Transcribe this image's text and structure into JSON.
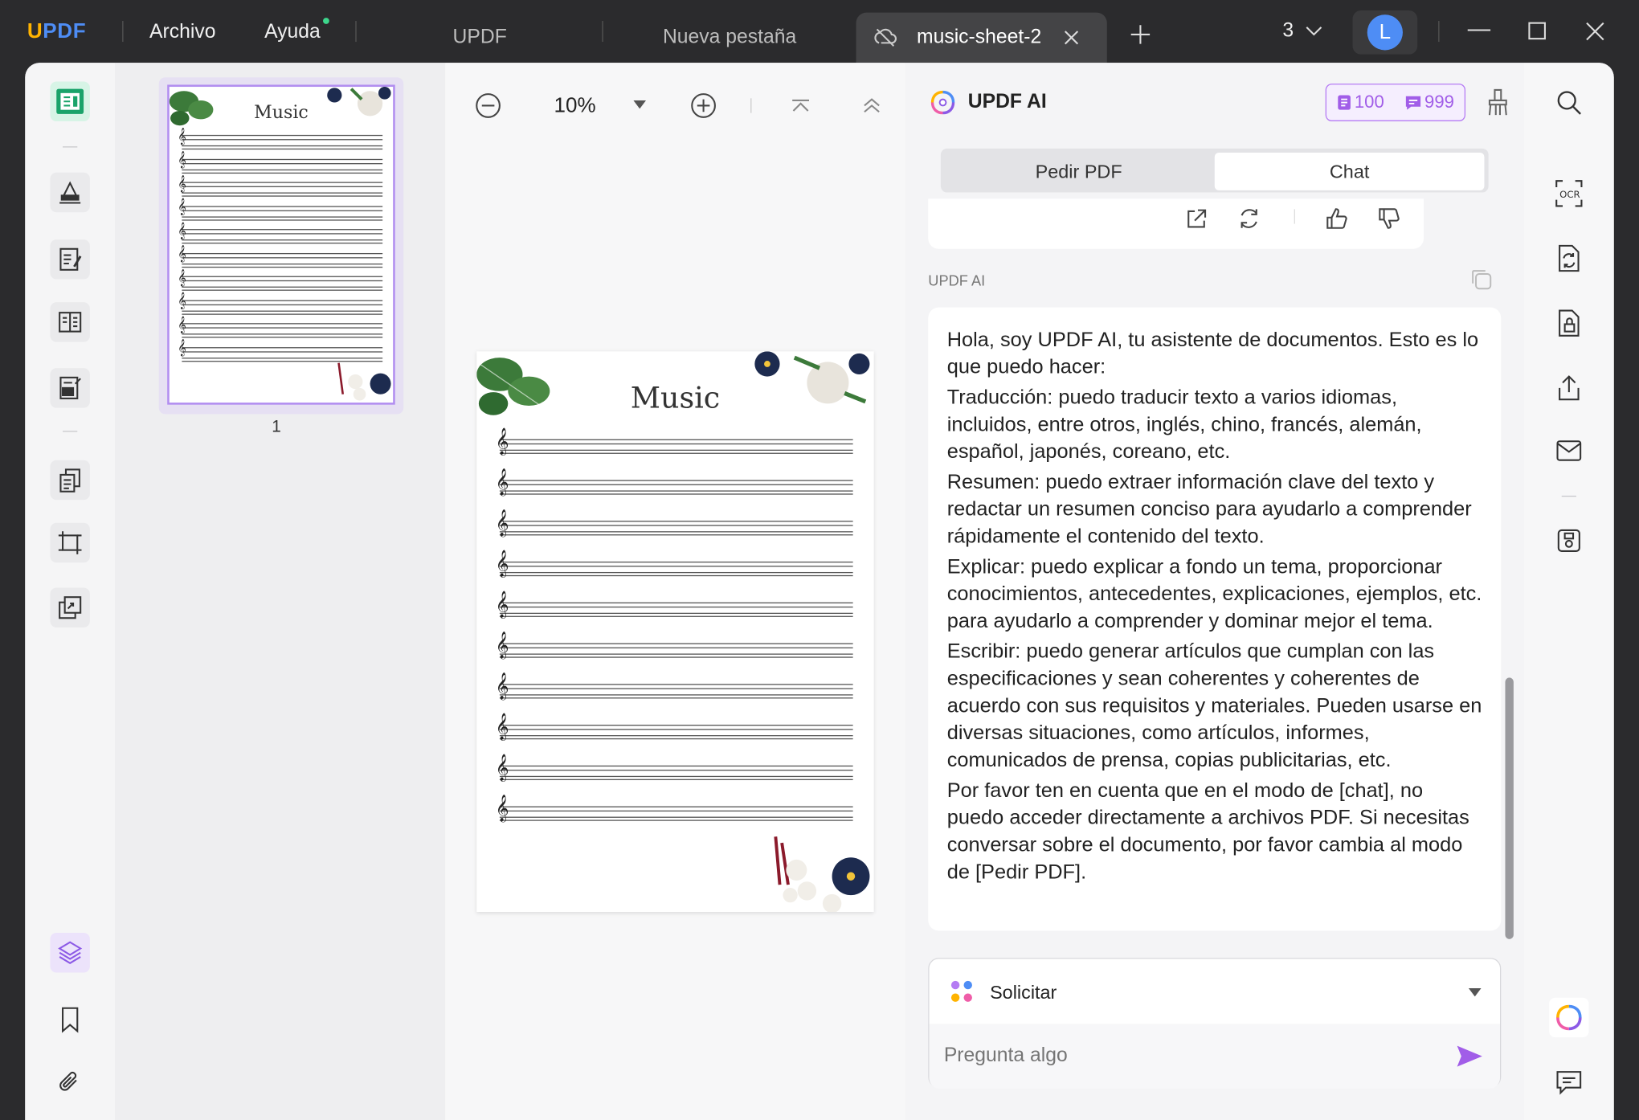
{
  "titlebar": {
    "logo": "UPDF",
    "menu": [
      "Archivo",
      "Ayuda"
    ],
    "tabs": [
      "UPDF",
      "Nueva pestaña",
      "music-sheet-2"
    ],
    "tab_count": "3",
    "avatar_initial": "L"
  },
  "colors": {
    "accent": "#a15de8",
    "logo_u": "#ffb300",
    "logo_pdf": "#4e8df5"
  },
  "thumbnail": {
    "page_number": "1",
    "title": "Music"
  },
  "viewer": {
    "zoom": "10%",
    "page_title": "Music"
  },
  "ai": {
    "title": "UPDF AI",
    "quota_pages": "100",
    "quota_chats": "999",
    "tabs": [
      "Pedir PDF",
      "Chat"
    ],
    "sender": "UPDF AI",
    "message": [
      "Hola, soy UPDF AI, tu asistente de documentos. Esto es lo que puedo hacer:",
      "Traducción: puedo traducir texto a varios idiomas, incluidos, entre otros, inglés, chino, francés, alemán, español, japonés, coreano, etc.",
      "Resumen: puedo extraer información clave del texto y redactar un resumen conciso para ayudarlo a comprender rápidamente el contenido del texto.",
      "Explicar: puedo explicar a fondo un tema, proporcionar conocimientos, antecedentes, explicaciones, ejemplos, etc. para ayudarlo a comprender y dominar mejor el tema.",
      "Escribir: puedo generar artículos que cumplan con las especificaciones y sean coherentes y coherentes de acuerdo con sus requisitos y materiales. Pueden usarse en diversas situaciones, como artículos, informes, comunicados de prensa, copias publicitarias, etc.",
      "Por favor ten en cuenta que en el modo de [chat], no puedo acceder directamente a archivos PDF. Si necesitas conversar sobre el documento, por favor cambia al modo de [Pedir PDF]."
    ],
    "prompt_selector": "Solicitar",
    "input_placeholder": "Pregunta algo"
  }
}
